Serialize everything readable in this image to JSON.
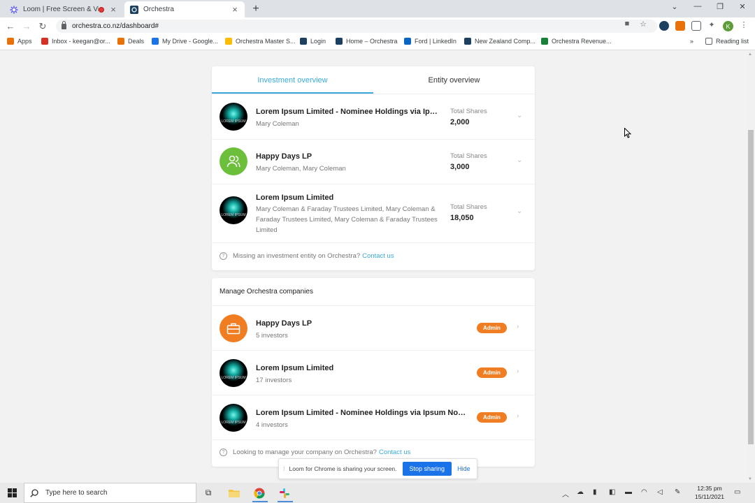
{
  "browser": {
    "tabs": [
      {
        "title": "Loom | Free Screen & Video",
        "favicon": "loom-icon",
        "recording": true
      },
      {
        "title": "Orchestra",
        "favicon": "orchestra-icon",
        "recording": false
      }
    ],
    "url": "orchestra.co.nz/dashboard#",
    "profile_initial": "K",
    "bookmarks": [
      {
        "label": "Apps",
        "icon": "apps-grid-icon",
        "color": "#e8710a"
      },
      {
        "label": "Inbox - keegan@or...",
        "icon": "gmail-icon",
        "color": "#d93025"
      },
      {
        "label": "Deals",
        "icon": "deals-icon",
        "color": "#e8710a"
      },
      {
        "label": "My Drive - Google...",
        "icon": "drive-icon",
        "color": "#1a73e8"
      },
      {
        "label": "Orchestra Master S...",
        "icon": "drive-icon",
        "color": "#fbbc04"
      },
      {
        "label": "Login",
        "icon": "orchestra-icon",
        "color": "#1b4060"
      },
      {
        "label": "Home – Orchestra",
        "icon": "orchestra-icon",
        "color": "#1b4060"
      },
      {
        "label": "Ford | LinkedIn",
        "icon": "linkedin-icon",
        "color": "#0a66c2"
      },
      {
        "label": "New Zealand Comp...",
        "icon": "nz-icon",
        "color": "#1b4060"
      },
      {
        "label": "Orchestra Revenue...",
        "icon": "sheets-icon",
        "color": "#188038"
      }
    ],
    "reading_list": "Reading list",
    "overflow": "»"
  },
  "overview_tabs": {
    "investment": "Investment overview",
    "entity": "Entity overview"
  },
  "investments": [
    {
      "name": "Lorem Ipsum Limited - Nominee Holdings via Ipsu...",
      "holders": "Mary Coleman",
      "shares_label": "Total Shares",
      "shares": "2,000",
      "logo": "lorem-logo"
    },
    {
      "name": "Happy Days LP",
      "holders": "Mary Coleman, Mary Coleman",
      "shares_label": "Total Shares",
      "shares": "3,000",
      "logo": "people-icon"
    },
    {
      "name": "Lorem Ipsum Limited",
      "holders": "Mary Coleman & Faraday Trustees Limited, Mary Coleman & Faraday Trustees Limited, Mary Coleman & Faraday Trustees Limited",
      "shares_label": "Total Shares",
      "shares": "18,050",
      "logo": "lorem-logo"
    }
  ],
  "logo_text": "LOREM IPSUM",
  "investments_footer": {
    "text": "Missing an investment entity on Orchestra?",
    "link": "Contact us"
  },
  "manage": {
    "title": "Manage Orchestra companies",
    "companies": [
      {
        "name": "Happy Days LP",
        "investors": "5 investors",
        "badge": "Admin",
        "logo": "briefcase-icon"
      },
      {
        "name": "Lorem Ipsum Limited",
        "investors": "17 investors",
        "badge": "Admin",
        "logo": "lorem-logo"
      },
      {
        "name": "Lorem Ipsum Limited - Nominee Holdings via Ipsum Nomi...",
        "investors": "4 investors",
        "badge": "Admin",
        "logo": "lorem-logo"
      }
    ],
    "footer": {
      "text": "Looking to manage your company on Orchestra?",
      "link": "Contact us"
    }
  },
  "loom": {
    "text": "Loom for Chrome is sharing your screen.",
    "stop": "Stop sharing",
    "hide": "Hide"
  },
  "taskbar": {
    "search_placeholder": "Type here to search",
    "time": "12:35 pm",
    "date": "15/11/2021"
  },
  "colors": {
    "accent": "#3aa9d9",
    "admin_badge": "#f07d22",
    "happy_days_green": "#6bbf3a",
    "briefcase_orange": "#f07d22"
  }
}
